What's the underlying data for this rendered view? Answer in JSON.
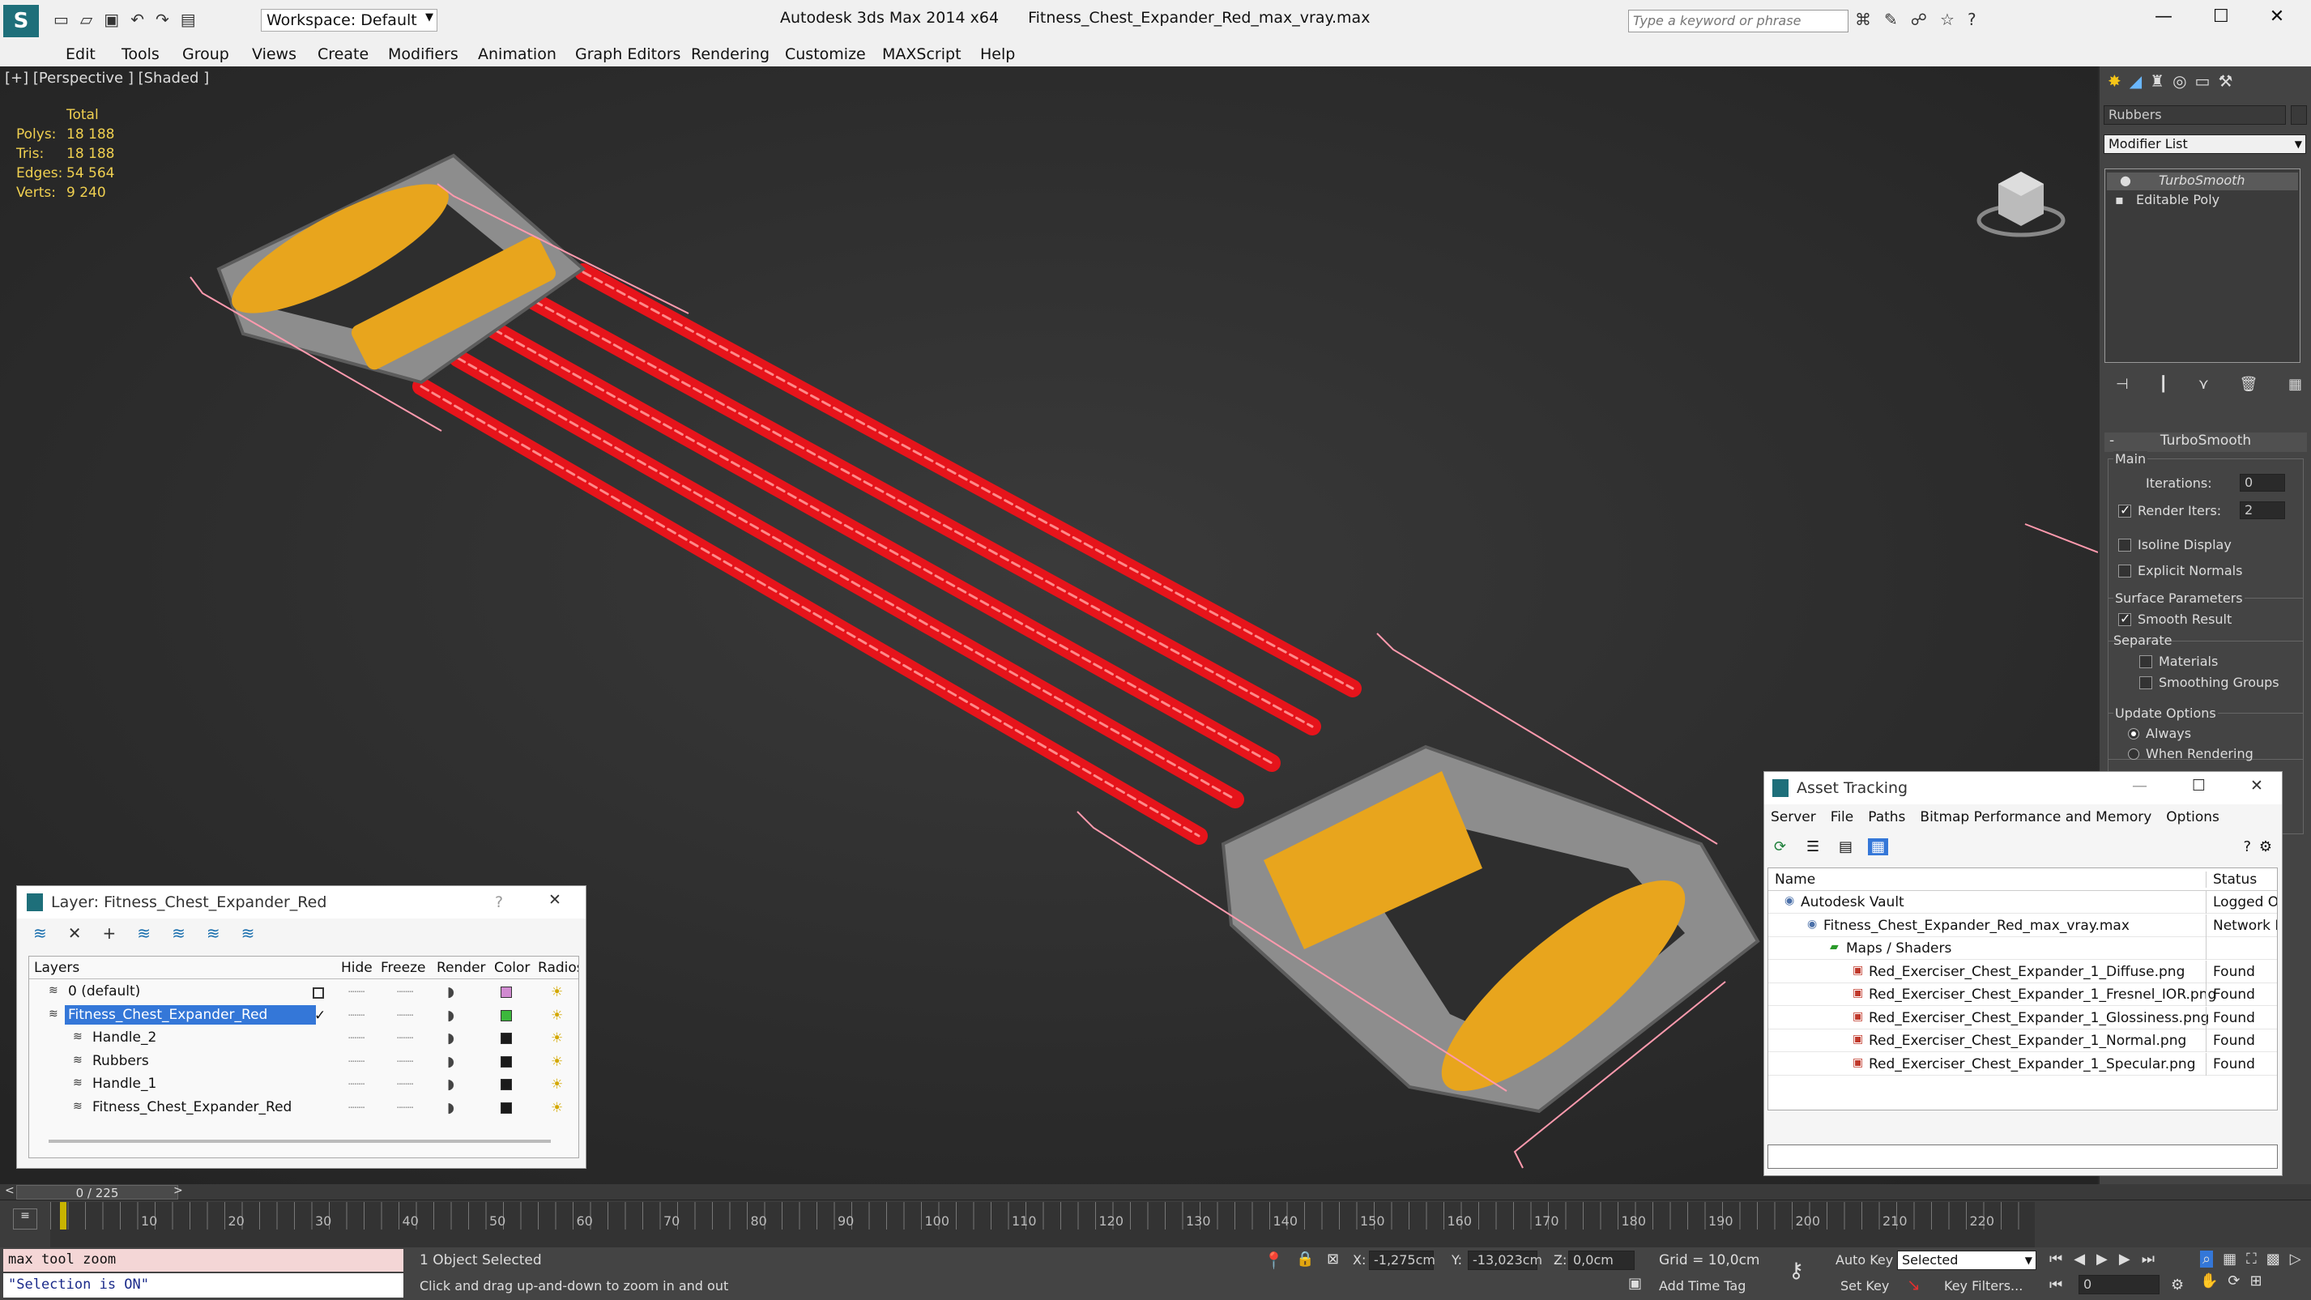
{
  "app": {
    "title": "Autodesk 3ds Max  2014 x64",
    "filename": "Fitness_Chest_Expander_Red_max_vray.max",
    "workspace": "Workspace: Default",
    "search_placeholder": "Type a keyword or phrase"
  },
  "menu": [
    "Edit",
    "Tools",
    "Group",
    "Views",
    "Create",
    "Modifiers",
    "Animation",
    "Graph Editors",
    "Rendering",
    "Customize",
    "MAXScript",
    "Help"
  ],
  "viewport": {
    "label": "[+] [Perspective ] [Shaded ]",
    "stats": {
      "header": "Total",
      "polys_label": "Polys:",
      "polys": "18 188",
      "tris_label": "Tris:",
      "tris": "18 188",
      "edges_label": "Edges:",
      "edges": "54 564",
      "verts_label": "Verts:",
      "verts": "9 240"
    }
  },
  "command_panel": {
    "object_name": "Rubbers",
    "modifier_list": "Modifier List",
    "stack": [
      "TurboSmooth",
      "Editable Poly"
    ],
    "rollout_title": "TurboSmooth",
    "main": "Main",
    "iterations_label": "Iterations:",
    "iterations": "0",
    "render_iters_label": "Render Iters:",
    "render_iters": "2",
    "isoline": "Isoline Display",
    "explicit_normals": "Explicit Normals",
    "surface_params": "Surface Parameters",
    "smooth_result": "Smooth Result",
    "separate": "Separate",
    "materials": "Materials",
    "smoothing_groups": "Smoothing Groups",
    "update_options": "Update Options",
    "always": "Always",
    "when_rendering": "When Rendering"
  },
  "asset_tracking": {
    "title": "Asset Tracking",
    "menu": [
      "Server",
      "File",
      "Paths",
      "Bitmap Performance and Memory",
      "Options"
    ],
    "col_name": "Name",
    "col_status": "Status",
    "rows": [
      {
        "name": "Autodesk Vault",
        "status": "Logged Ou",
        "indent": 1
      },
      {
        "name": "Fitness_Chest_Expander_Red_max_vray.max",
        "status": "Network Pa",
        "indent": 2
      },
      {
        "name": "Maps / Shaders",
        "status": "",
        "indent": 3
      },
      {
        "name": "Red_Exerciser_Chest_Expander_1_Diffuse.png",
        "status": "Found",
        "indent": 4
      },
      {
        "name": "Red_Exerciser_Chest_Expander_1_Fresnel_IOR.png",
        "status": "Found",
        "indent": 4
      },
      {
        "name": "Red_Exerciser_Chest_Expander_1_Glossiness.png",
        "status": "Found",
        "indent": 4
      },
      {
        "name": "Red_Exerciser_Chest_Expander_1_Normal.png",
        "status": "Found",
        "indent": 4
      },
      {
        "name": "Red_Exerciser_Chest_Expander_1_Specular.png",
        "status": "Found",
        "indent": 4
      }
    ]
  },
  "layer_dialog": {
    "title": "Layer: Fitness_Chest_Expander_Red",
    "help": "?",
    "cols": [
      "Layers",
      "Hide",
      "Freeze",
      "Render",
      "Color",
      "Radiosi"
    ],
    "rows": [
      {
        "name": "0 (default)",
        "indent": 1,
        "color": "#d08ad0",
        "selected": false
      },
      {
        "name": "Fitness_Chest_Expander_Red",
        "indent": 1,
        "color": "#3cb83c",
        "selected": true
      },
      {
        "name": "Handle_2",
        "indent": 2,
        "color": "#1a1a1a",
        "selected": false
      },
      {
        "name": "Rubbers",
        "indent": 2,
        "color": "#1a1a1a",
        "selected": false
      },
      {
        "name": "Handle_1",
        "indent": 2,
        "color": "#1a1a1a",
        "selected": false
      },
      {
        "name": "Fitness_Chest_Expander_Red",
        "indent": 2,
        "color": "#1a1a1a",
        "selected": false
      }
    ]
  },
  "timeline": {
    "frame": "0 / 225",
    "ticks": [
      "10",
      "20",
      "30",
      "40",
      "50",
      "60",
      "70",
      "80",
      "90",
      "100",
      "110",
      "120",
      "130",
      "140",
      "150",
      "160",
      "170",
      "180",
      "190",
      "200",
      "210",
      "220"
    ]
  },
  "status": {
    "script1": "max tool zoom",
    "script2": "\"Selection is ON\"",
    "selected": "1 Object Selected",
    "hint": "Click and drag up-and-down to zoom in and out",
    "x_label": "X:",
    "x": "-1,275cm",
    "y_label": "Y:",
    "y": "-13,023cm",
    "z_label": "Z:",
    "z": "0,0cm",
    "grid": "Grid = 10,0cm",
    "add_time_tag": "Add Time Tag",
    "auto_key": "Auto Key",
    "set_key": "Set Key",
    "key_mode": "Selected",
    "key_filters": "Key Filters...",
    "frame_field": "0"
  }
}
